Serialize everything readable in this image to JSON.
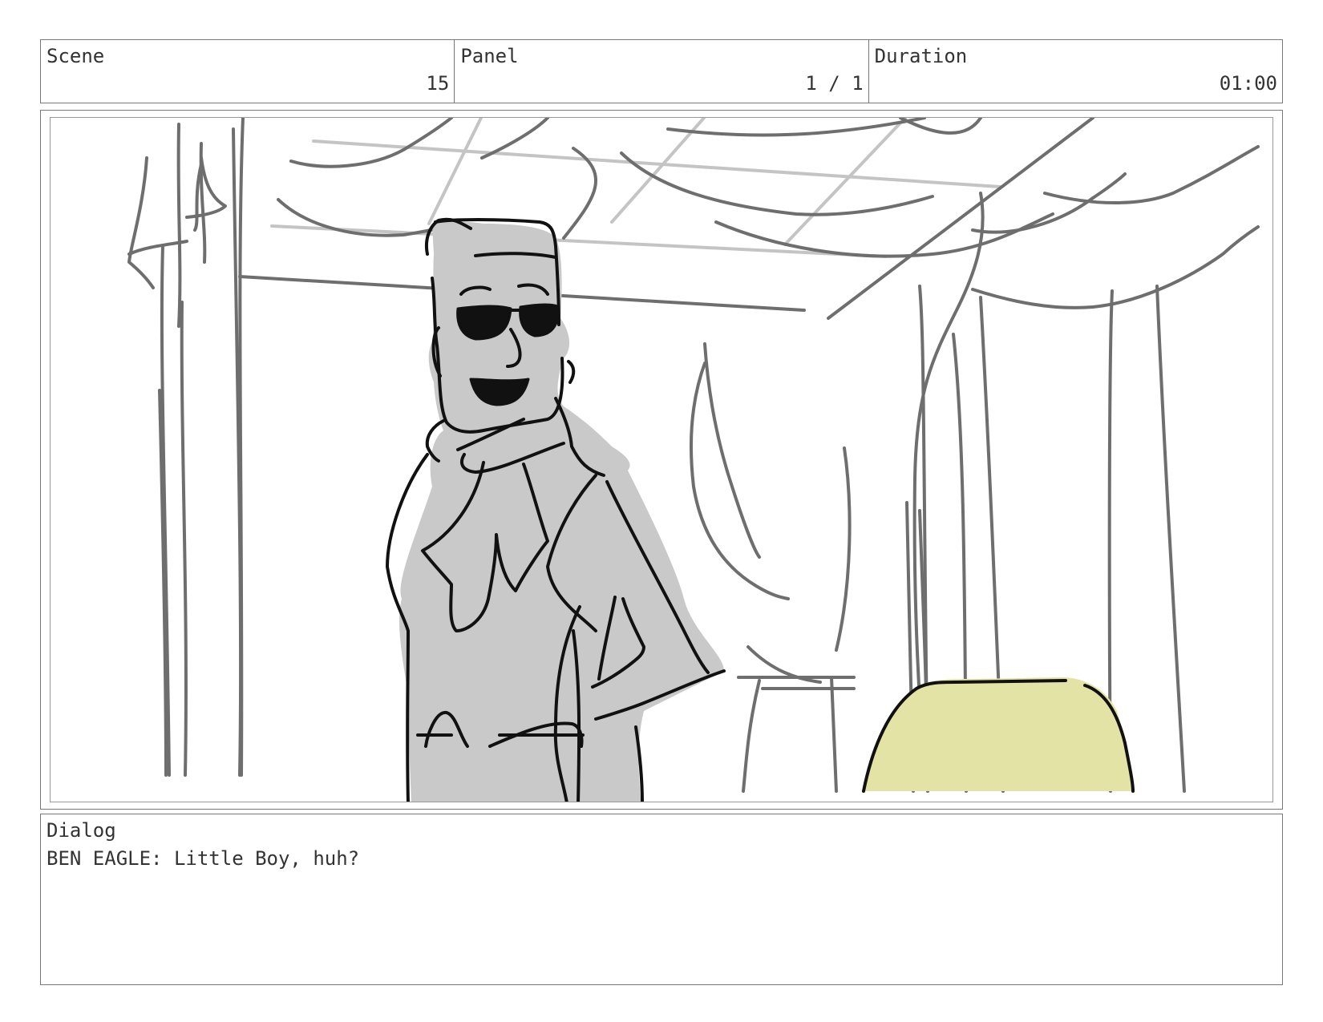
{
  "header": {
    "scene_label": "Scene",
    "scene_value": "15",
    "panel_label": "Panel",
    "panel_value": "1 / 1",
    "duration_label": "Duration",
    "duration_value": "01:00"
  },
  "dialog": {
    "label": "Dialog",
    "text": "BEN EAGLE: Little Boy, huh?"
  },
  "colors": {
    "border": "#777777",
    "text": "#333333",
    "sketch_line": "#6e6e6e",
    "sketch_light": "#bdbdbd",
    "figure_fill": "#c9c9c9",
    "figure_line": "#111111",
    "chair_fill": "#e3e3a6"
  }
}
